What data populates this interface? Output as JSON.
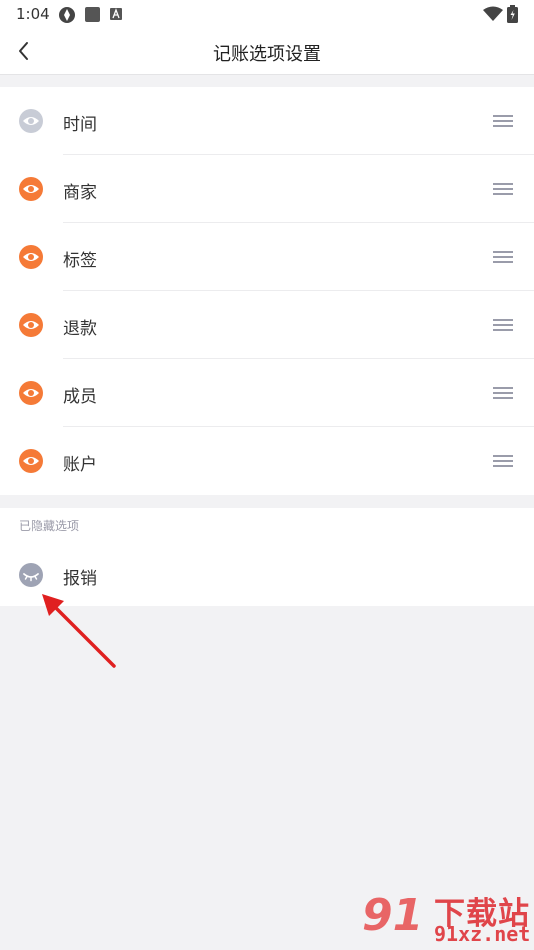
{
  "status_bar": {
    "time": "1:04",
    "icons": [
      "notification-icon",
      "app-square-icon",
      "font-a-icon",
      "wifi-icon",
      "battery-icon"
    ]
  },
  "header": {
    "title": "记账选项设置",
    "back_icon": "chevron-left-icon"
  },
  "visible_options": [
    {
      "label": "时间",
      "eye_state": "visible-disabled",
      "eye_color": "#c8ccd6"
    },
    {
      "label": "商家",
      "eye_state": "visible",
      "eye_color": "#f57a37"
    },
    {
      "label": "标签",
      "eye_state": "visible",
      "eye_color": "#f57a37"
    },
    {
      "label": "退款",
      "eye_state": "visible",
      "eye_color": "#f57a37"
    },
    {
      "label": "成员",
      "eye_state": "visible",
      "eye_color": "#f57a37"
    },
    {
      "label": "账户",
      "eye_state": "visible",
      "eye_color": "#f57a37"
    }
  ],
  "hidden_section": {
    "title": "已隐藏选项",
    "items": [
      {
        "label": "报销",
        "eye_state": "hidden",
        "eye_color": "#9ea3b4"
      }
    ]
  },
  "annotation": {
    "arrow_color": "#e02020"
  },
  "watermark": {
    "logo": "91",
    "text": "下载站",
    "url": "91xz.net"
  },
  "colors": {
    "accent": "#f57a37",
    "background": "#f2f2f4",
    "handle": "#9a9caa"
  }
}
